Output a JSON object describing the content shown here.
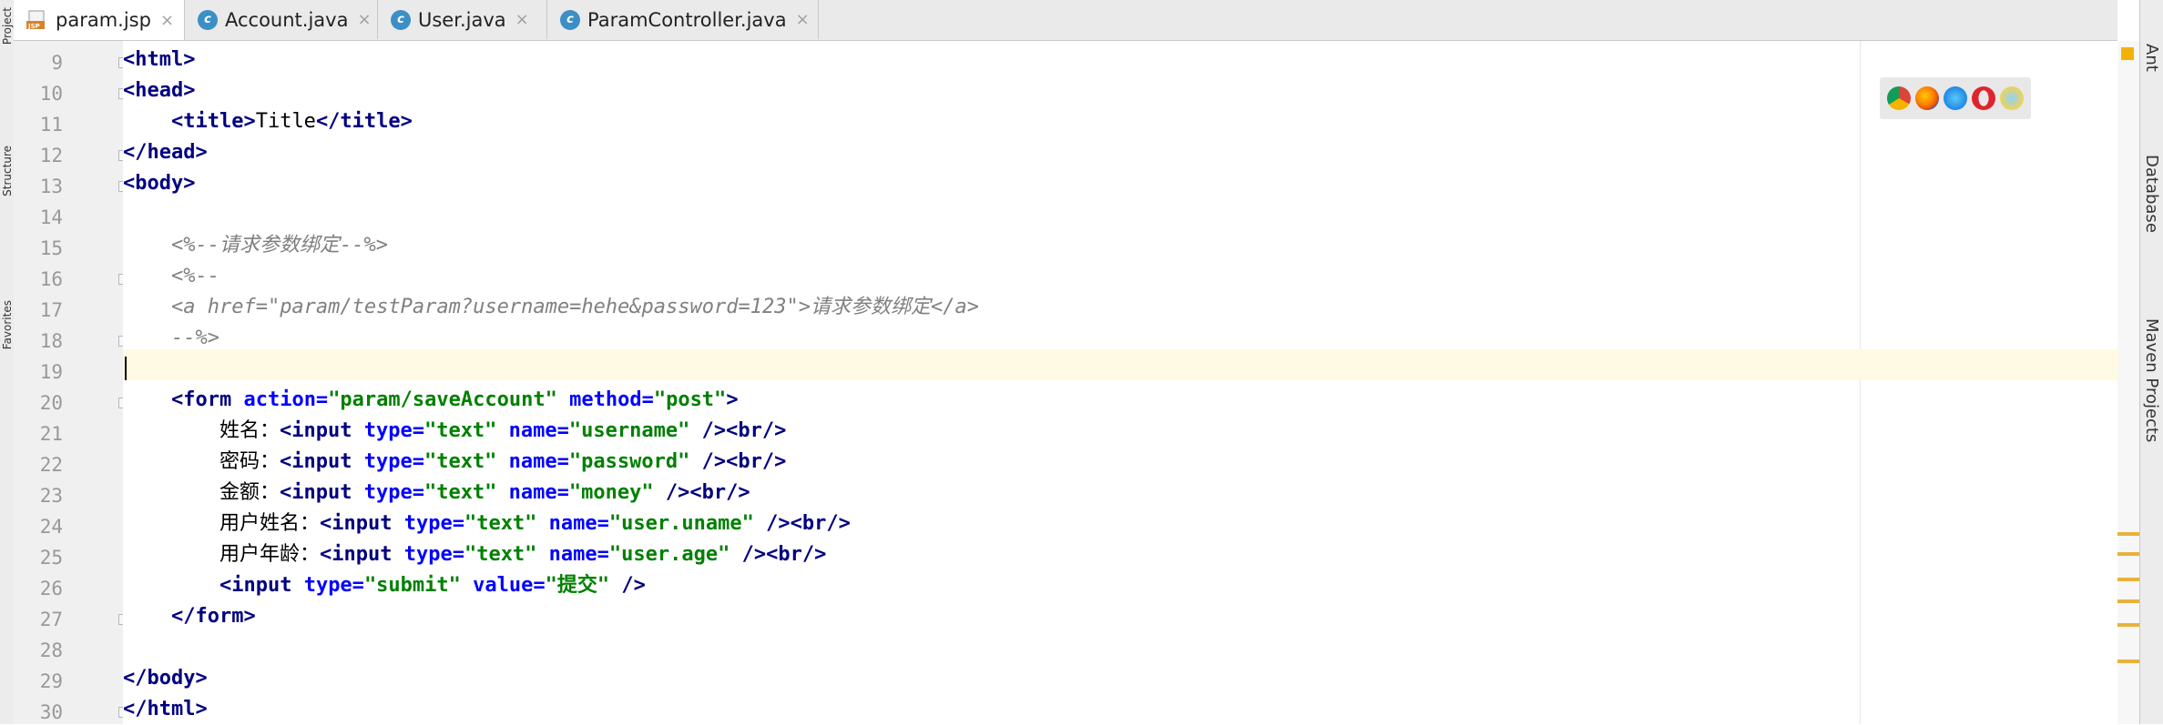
{
  "tabs": [
    {
      "label": "param.jsp",
      "icon": "jsp-file-icon",
      "active": true
    },
    {
      "label": "Account.java",
      "icon": "java-class-icon",
      "active": false
    },
    {
      "label": "User.java",
      "icon": "java-class-icon",
      "active": false
    },
    {
      "label": "ParamController.java",
      "icon": "java-class-icon",
      "active": false
    }
  ],
  "left_tools": [
    "Project",
    "Structure",
    "Favorites"
  ],
  "right_tools": [
    "Ant",
    "Database",
    "Maven Projects"
  ],
  "browsers": [
    "chrome-icon",
    "firefox-icon",
    "safari-icon",
    "opera-icon",
    "ie-icon"
  ],
  "line_numbers": [
    "9",
    "10",
    "11",
    "12",
    "13",
    "14",
    "15",
    "16",
    "17",
    "18",
    "19",
    "20",
    "21",
    "22",
    "23",
    "24",
    "25",
    "26",
    "27",
    "28",
    "29",
    "30"
  ],
  "code": {
    "l9": {
      "t1": "<html>"
    },
    "l10": {
      "t1": "<head>"
    },
    "l11": {
      "t1": "<title>",
      "text": "Title",
      "t2": "</title>"
    },
    "l12": {
      "t1": "</head>"
    },
    "l13": {
      "t1": "<body>"
    },
    "l15": {
      "comment": "<%--请求参数绑定--%>"
    },
    "l16": {
      "comment": "<%--"
    },
    "l17": {
      "comment": "<a href=\"param/testParam?username=hehe&password=123\">请求参数绑定</a>"
    },
    "l18": {
      "comment": "--%>"
    },
    "l20": {
      "t1": "<form",
      "a1": " action=",
      "v1": "\"param/saveAccount\"",
      "a2": " method=",
      "v2": "\"post\"",
      "t2": ">"
    },
    "l21": {
      "label": "姓名：",
      "t1": "<input",
      "a1": " type=",
      "v1": "\"text\"",
      "a2": " name=",
      "v2": "\"username\"",
      "t2": " /><br/>"
    },
    "l22": {
      "label": "密码：",
      "t1": "<input",
      "a1": " type=",
      "v1": "\"text\"",
      "a2": " name=",
      "v2": "\"password\"",
      "t2": " /><br/>"
    },
    "l23": {
      "label": "金额：",
      "t1": "<input",
      "a1": " type=",
      "v1": "\"text\"",
      "a2": " name=",
      "v2": "\"money\"",
      "t2": " /><br/>"
    },
    "l24": {
      "label": "用户姓名：",
      "t1": "<input",
      "a1": " type=",
      "v1": "\"text\"",
      "a2": " name=",
      "v2": "\"user.uname\"",
      "t2": " /><br/>"
    },
    "l25": {
      "label": "用户年龄：",
      "t1": "<input",
      "a1": " type=",
      "v1": "\"text\"",
      "a2": " name=",
      "v2": "\"user.age\"",
      "t2": " /><br/>"
    },
    "l26": {
      "t1": "<input",
      "a1": " type=",
      "v1": "\"submit\"",
      "a2": " value=",
      "v2": "\"提交\"",
      "t2": " />"
    },
    "l27": {
      "t1": "</form>"
    },
    "l29": {
      "t1": "</body>"
    },
    "l30": {
      "t1": "</html>"
    }
  },
  "colors": {
    "tag": "#000080",
    "attr": "#0000ff",
    "value": "#008000",
    "comment": "#808080",
    "caret_line": "#fffae3"
  }
}
